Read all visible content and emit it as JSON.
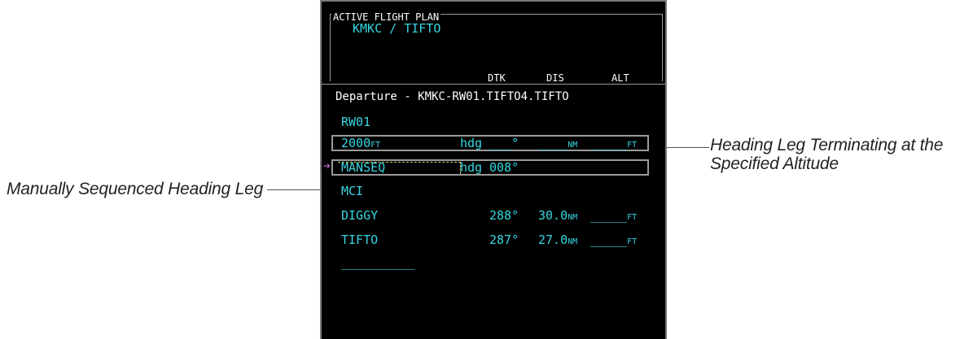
{
  "callouts": {
    "left": "Manually Sequenced Heading Leg",
    "right_line1": "Heading Leg Terminating at the",
    "right_line2": "Specified Altitude"
  },
  "panel": {
    "title": "ACTIVE FLIGHT PLAN",
    "route": "KMKC / TIFTO",
    "headers": {
      "dtk": "DTK",
      "dis": "DIS",
      "alt": "ALT"
    },
    "departure_label": "Departure - KMKC-RW01.TIFTO4.TIFTO",
    "rows": [
      {
        "name": "RW01",
        "name_unit": "",
        "type": "",
        "dtk": "",
        "dis": "",
        "dis_unit": "",
        "alt": "",
        "alt_unit": ""
      },
      {
        "name": "2000",
        "name_unit": "FT",
        "type": "hdg",
        "dtk": "___°",
        "dis": "____",
        "dis_unit": "NM",
        "alt": "_____",
        "alt_unit": "FT"
      },
      {
        "name": "MANSEQ",
        "name_unit": "",
        "type": "hdg",
        "dtk": "008°",
        "dis": "",
        "dis_unit": "",
        "alt": "",
        "alt_unit": ""
      },
      {
        "name": "MCI",
        "name_unit": "",
        "type": "",
        "dtk": "",
        "dis": "",
        "dis_unit": "",
        "alt": "",
        "alt_unit": ""
      },
      {
        "name": "DIGGY",
        "name_unit": "",
        "type": "",
        "dtk": "288°",
        "dis": "30.0",
        "dis_unit": "NM",
        "alt": "_____",
        "alt_unit": "FT"
      },
      {
        "name": "TIFTO",
        "name_unit": "",
        "type": "",
        "dtk": "287°",
        "dis": "27.0",
        "dis_unit": "NM",
        "alt": "_____",
        "alt_unit": "FT"
      }
    ],
    "empty_slot": "__________"
  },
  "colors": {
    "panel_bg": "#000000",
    "waypoint": "#36d6e0",
    "text": "#ffffff",
    "active_arrow": "#c060d0",
    "box": "#9a9a9a"
  },
  "icons": {
    "active_leg": "magenta-arrow-icon"
  }
}
